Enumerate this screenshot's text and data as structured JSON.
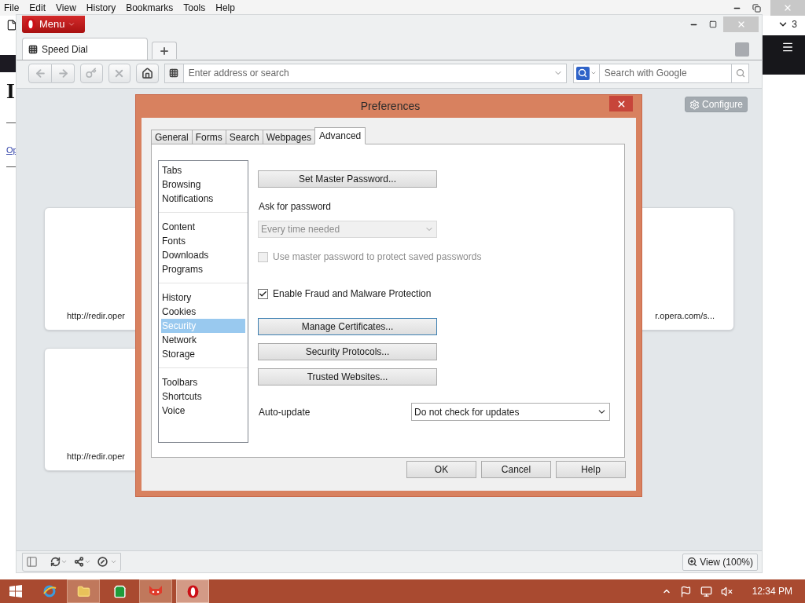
{
  "outer_window": {
    "menubar": [
      "File",
      "Edit",
      "View",
      "History",
      "Bookmarks",
      "Tools",
      "Help"
    ],
    "page_heading": "I",
    "page_link": "Op",
    "tab_count": "3"
  },
  "browser": {
    "menu_button": "Menu",
    "tabs": [
      {
        "label": "Speed Dial",
        "selected": true
      }
    ],
    "address_placeholder": "Enter address or search",
    "search_placeholder": "Search with Google",
    "configure_button": "Configure",
    "speed_dial": [
      {
        "url": "http://redir.oper"
      },
      {
        "url": "r.opera.com/s..."
      },
      {
        "url": "http://redir.oper"
      }
    ],
    "status_bar": {
      "zoom_button": "View (100%)"
    }
  },
  "dialog": {
    "title": "Preferences",
    "tabs": [
      {
        "label": "General",
        "selected": false
      },
      {
        "label": "Forms",
        "selected": false
      },
      {
        "label": "Search",
        "selected": false
      },
      {
        "label": "Webpages",
        "selected": false
      },
      {
        "label": "Advanced",
        "selected": true
      }
    ],
    "categories": [
      [
        {
          "label": "Tabs",
          "selected": false
        },
        {
          "label": "Browsing",
          "selected": false
        },
        {
          "label": "Notifications",
          "selected": false
        }
      ],
      [
        {
          "label": "Content",
          "selected": false
        },
        {
          "label": "Fonts",
          "selected": false
        },
        {
          "label": "Downloads",
          "selected": false
        },
        {
          "label": "Programs",
          "selected": false
        }
      ],
      [
        {
          "label": "History",
          "selected": false
        },
        {
          "label": "Cookies",
          "selected": false
        },
        {
          "label": "Security",
          "selected": true
        },
        {
          "label": "Network",
          "selected": false
        },
        {
          "label": "Storage",
          "selected": false
        }
      ],
      [
        {
          "label": "Toolbars",
          "selected": false
        },
        {
          "label": "Shortcuts",
          "selected": false
        },
        {
          "label": "Voice",
          "selected": false
        }
      ]
    ],
    "master_password_button": "Set Master Password...",
    "ask_for_password_label": "Ask for password",
    "ask_for_password_select": {
      "value": "Every time needed",
      "disabled": true
    },
    "use_master_password": {
      "label": "Use master password to protect saved passwords",
      "checked": false,
      "disabled": true
    },
    "fraud_protection": {
      "label": "Enable Fraud and Malware Protection",
      "checked": true,
      "disabled": false
    },
    "security_buttons": [
      {
        "label": "Manage Certificates...",
        "focused": true
      },
      {
        "label": "Security Protocols...",
        "focused": false
      },
      {
        "label": "Trusted Websites...",
        "focused": false
      }
    ],
    "auto_update": {
      "label": "Auto-update",
      "value": "Do not check for updates"
    },
    "buttons": [
      "OK",
      "Cancel",
      "Help"
    ]
  },
  "taskbar": {
    "clock": "12:34 PM"
  }
}
